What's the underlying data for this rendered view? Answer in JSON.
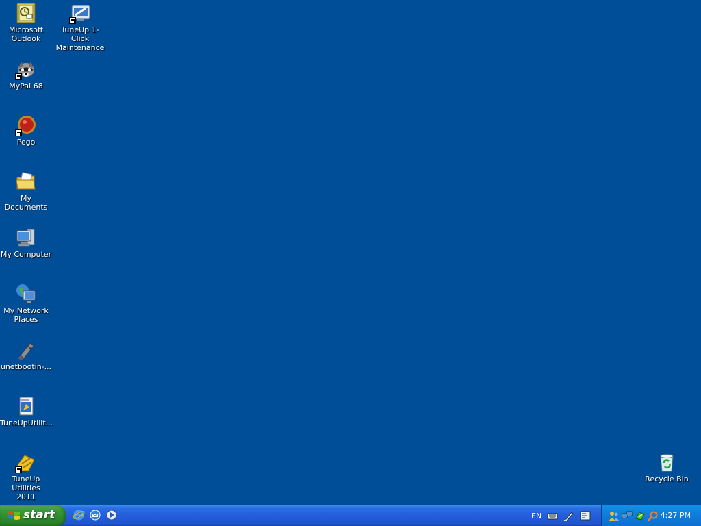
{
  "desktop": {
    "background_color": "#004e98",
    "icons": [
      {
        "label": "Microsoft\nOutlook",
        "icon": "outlook-icon"
      },
      {
        "label": "TuneUp 1-Click\nMaintenance",
        "icon": "tuneup-maintenance-icon"
      },
      {
        "label": "MyPal 68",
        "icon": "mypal-icon"
      },
      {
        "label": "Pego",
        "icon": "pego-icon"
      },
      {
        "label": "My Documents",
        "icon": "my-documents-icon"
      },
      {
        "label": "My Computer",
        "icon": "my-computer-icon"
      },
      {
        "label": "My Network\nPlaces",
        "icon": "network-places-icon"
      },
      {
        "label": "unetbootin-...",
        "icon": "unetbootin-icon"
      },
      {
        "label": "TuneUpUtilit...",
        "icon": "tuneup-installer-icon"
      },
      {
        "label": "TuneUp Utilities\n2011",
        "icon": "tuneup-utilities-icon"
      },
      {
        "label": "Recycle Bin",
        "icon": "recycle-bin-icon"
      }
    ]
  },
  "taskbar": {
    "start_label": "start",
    "quick_launch": [
      "internet-explorer-icon",
      "outlook-express-icon",
      "media-player-icon"
    ],
    "language": "EN",
    "language_bar_icons": [
      "keyboard-icon",
      "handwriting-icon",
      "language-options-icon"
    ],
    "tray_icons": [
      "users-icon",
      "network-icon",
      "tuneup-tray-icon",
      "search-tray-icon"
    ],
    "clock": "4:27 PM"
  }
}
